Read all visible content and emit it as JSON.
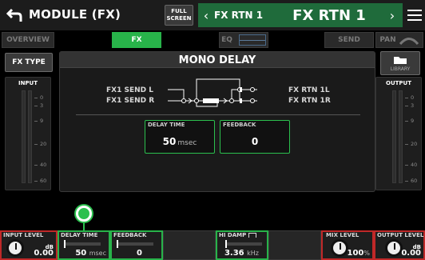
{
  "header": {
    "title": "MODULE (FX)",
    "fullscreen_line1": "FULL",
    "fullscreen_line2": "SCREEN",
    "prev_label": "FX RTN 1",
    "current_label": "FX RTN 1"
  },
  "tabs": {
    "overview": "OVERVIEW",
    "fx": "FX",
    "eq": "EQ",
    "send": "SEND",
    "pan": "PAN"
  },
  "fx_type_label": "FX TYPE",
  "library_label": "LIBRARY",
  "input_meter": {
    "title": "INPUT",
    "scale": [
      "0",
      "3",
      "9",
      "20",
      "40",
      "60"
    ]
  },
  "output_meter": {
    "title": "OUTPUT",
    "scale": [
      "0",
      "3",
      "9",
      "20",
      "40",
      "60"
    ]
  },
  "effect": {
    "name": "MONO DELAY",
    "inputs": [
      "FX1 SEND L",
      "FX1 SEND R"
    ],
    "outputs": [
      "FX RTN 1L",
      "FX RTN 1R"
    ],
    "params": [
      {
        "label": "DELAY TIME",
        "value": "50",
        "unit": "msec"
      },
      {
        "label": "FEEDBACK",
        "value": "0",
        "unit": ""
      }
    ]
  },
  "bottom": {
    "input_level": {
      "label": "INPUT LEVEL",
      "value": "0.00",
      "unit": "dB"
    },
    "delay_time": {
      "label": "DELAY TIME",
      "value": "50",
      "unit": "msec"
    },
    "feedback": {
      "label": "FEEDBACK",
      "value": "0"
    },
    "hi_damp": {
      "label": "HI DAMP",
      "value": "3.36",
      "unit": "kHz"
    },
    "mix_level": {
      "label": "MIX LEVEL",
      "value": "100",
      "unit": "%"
    },
    "output_level": {
      "label": "OUTPUT LEVEL",
      "value": "0.00",
      "unit": "dB"
    }
  },
  "colors": {
    "accent_green": "#28b34a",
    "header_green": "#1f6b3b",
    "alert_red": "#c02828"
  }
}
